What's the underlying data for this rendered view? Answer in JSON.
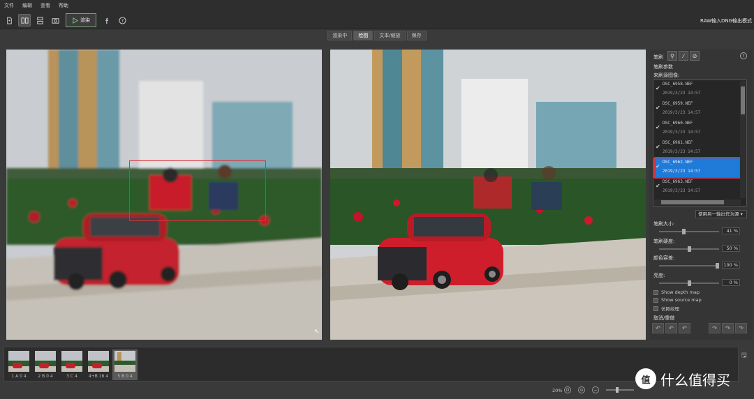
{
  "menu": [
    "文件",
    "编辑",
    "查看",
    "帮助"
  ],
  "toolbar": {
    "render_label": "渲染",
    "mode_label": "RAW输入DNG输出模式"
  },
  "tabs": [
    {
      "label": "渲染中",
      "active": false
    },
    {
      "label": "绘图",
      "active": true
    },
    {
      "label": "文本/缩放",
      "active": false
    },
    {
      "label": "保存",
      "active": false
    }
  ],
  "panel": {
    "title": "笔刷",
    "params_label": "笔刷参数",
    "source_label": "来刷源图像:",
    "files": [
      {
        "name": "DSC_6958.NEF",
        "date": "2019/3/23 14:57",
        "checked": true,
        "selected": false
      },
      {
        "name": "DSC_6959.NEF",
        "date": "2019/3/23 14:57",
        "checked": true,
        "selected": false
      },
      {
        "name": "DSC_6960.NEF",
        "date": "2019/3/23 14:57",
        "checked": true,
        "selected": false
      },
      {
        "name": "DSC_6961.NEF",
        "date": "2019/3/23 14:57",
        "checked": true,
        "selected": false
      },
      {
        "name": "DSC_6962.NEF",
        "date": "2019/3/23 14:57",
        "checked": true,
        "selected": true
      },
      {
        "name": "DSC_6963.NEF",
        "date": "2019/3/23 14:57",
        "checked": true,
        "selected": false
      }
    ],
    "source_select": "使用另一输出作为源",
    "sliders": [
      {
        "label": "笔刷大小:",
        "value": "41 %",
        "level": 0.41
      },
      {
        "label": "笔刷硬度:",
        "value": "50 %",
        "level": 0.5
      },
      {
        "label": "颜色容差:",
        "value": "100 %",
        "level": 1.0
      },
      {
        "label": "亮度:",
        "value": "0 %",
        "level": 0.5
      }
    ],
    "checkboxes": [
      "Show depth map",
      "Show source map",
      "仿照纹理"
    ],
    "undo_label": "取消/重做"
  },
  "filmstrip": [
    {
      "caption": "1 A 0 4",
      "active": false
    },
    {
      "caption": "2 B 0 4",
      "active": false
    },
    {
      "caption": "3 C 4",
      "active": false
    },
    {
      "caption": "4+B 16 4",
      "active": false
    },
    {
      "caption": "5 B 0 4",
      "active": true
    }
  ],
  "status": {
    "zoom": "20%"
  },
  "watermark": "什么值得买"
}
